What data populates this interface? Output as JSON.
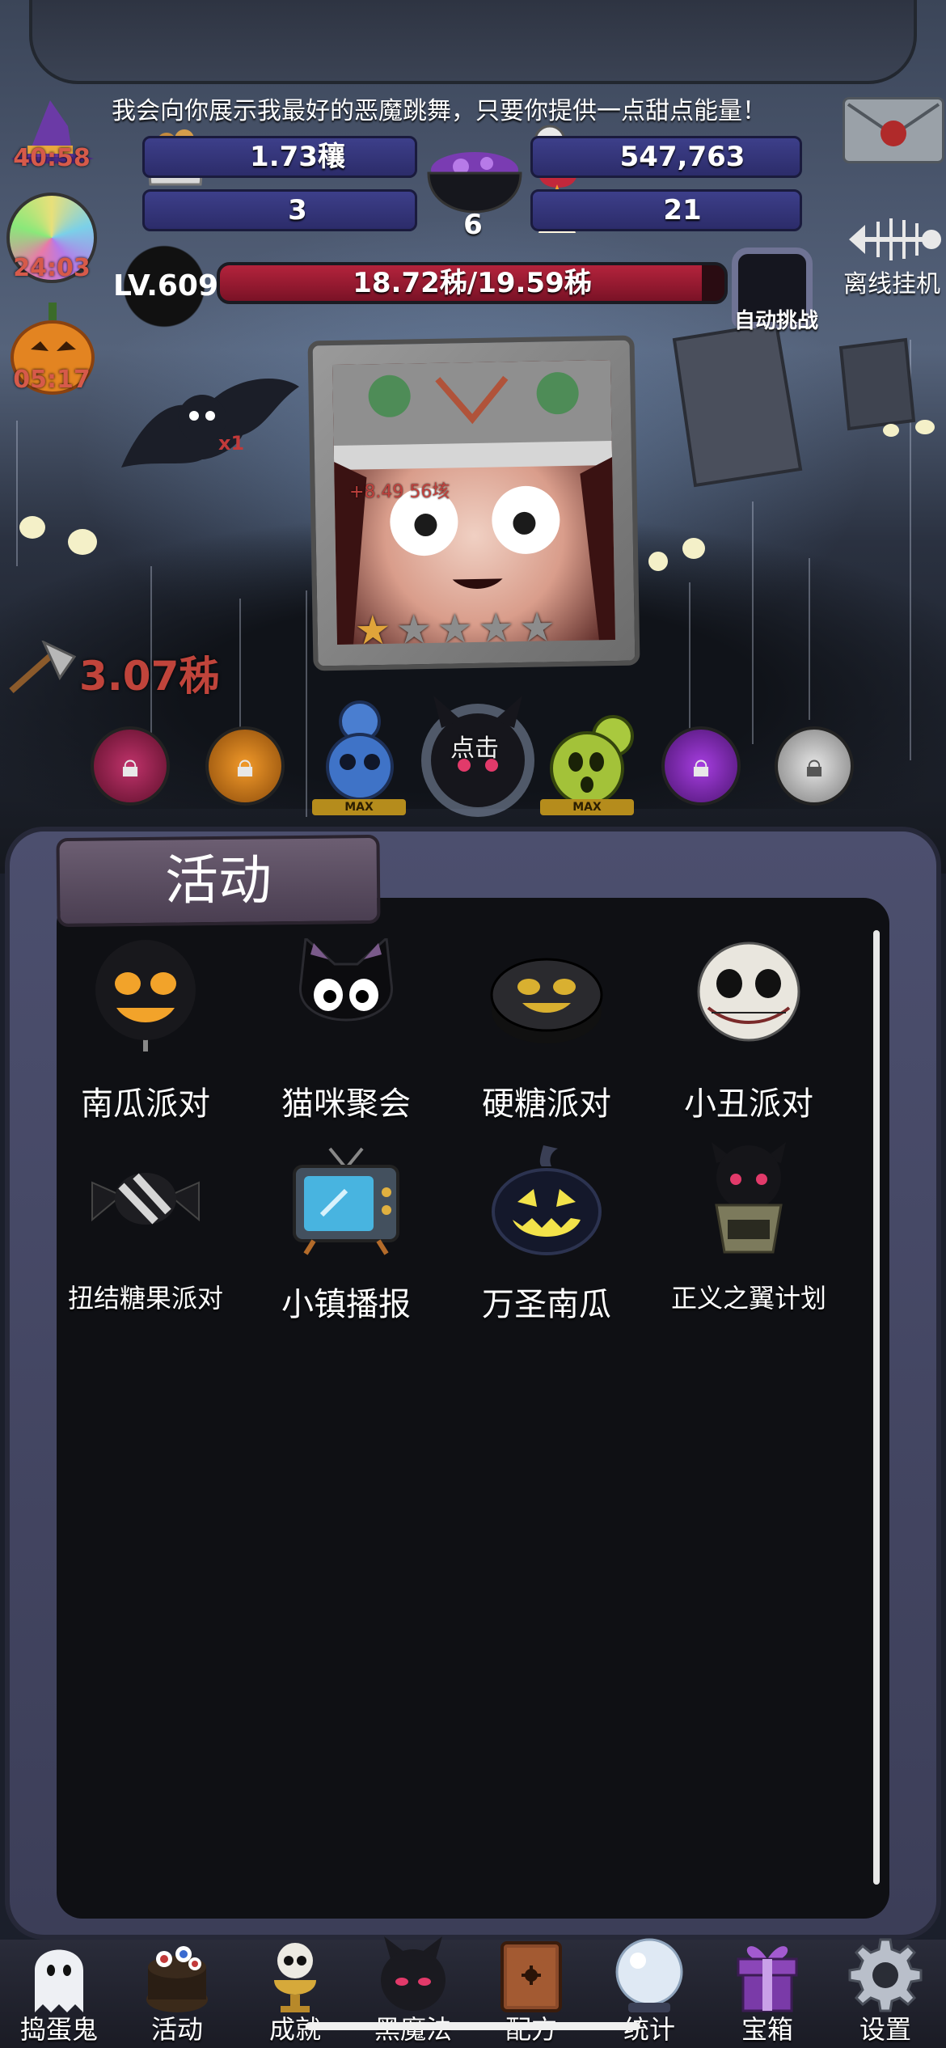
{
  "speech": "我会向你展示我最好的恶魔跳舞，只要你提供一点甜点能量！",
  "resources": {
    "cookies": "1.73穰",
    "potion": "547,763",
    "candy_wrap": "3",
    "cauldron": "6",
    "candy_corn": "21"
  },
  "timers": {
    "witch_hat": "40:58",
    "lollipop": "24:03",
    "pumpkin": "05:17"
  },
  "level": "LV.609",
  "xp": {
    "text": "18.72秭/19.59秭",
    "fraction": 0.955
  },
  "auto_challenge_label": "自动挑战",
  "offline_label": "离线挂机",
  "damage_popup": "+8.49 56垓",
  "dps": "3.07秭",
  "tap_hint": "点击",
  "stars": {
    "filled": 1,
    "total": 5
  },
  "max_label": "MAX",
  "panel_title": "活动",
  "activities": [
    {
      "label": "南瓜派对",
      "icon": "jack-o-lantern-lollipop-icon"
    },
    {
      "label": "猫咪聚会",
      "icon": "black-cat-icon"
    },
    {
      "label": "硬糖派对",
      "icon": "hard-candy-icon"
    },
    {
      "label": "小丑派对",
      "icon": "skull-clown-icon"
    },
    {
      "label": "扭结糖果派对",
      "icon": "wrapped-candy-icon"
    },
    {
      "label": "小镇播报",
      "icon": "tv-icon"
    },
    {
      "label": "万圣南瓜",
      "icon": "pumpkin-icon"
    },
    {
      "label": "正义之翼计划",
      "icon": "winged-demon-icon"
    }
  ],
  "nav": [
    {
      "label": "捣蛋鬼",
      "icon": "ghost-icon"
    },
    {
      "label": "活动",
      "icon": "eyeball-cake-icon"
    },
    {
      "label": "成就",
      "icon": "skull-trophy-icon"
    },
    {
      "label": "黑魔法",
      "icon": "demon-head-icon"
    },
    {
      "label": "配方",
      "icon": "spellbook-icon"
    },
    {
      "label": "统计",
      "icon": "crystal-ball-icon"
    },
    {
      "label": "宝箱",
      "icon": "gift-box-icon"
    },
    {
      "label": "设置",
      "icon": "gear-icon"
    }
  ]
}
